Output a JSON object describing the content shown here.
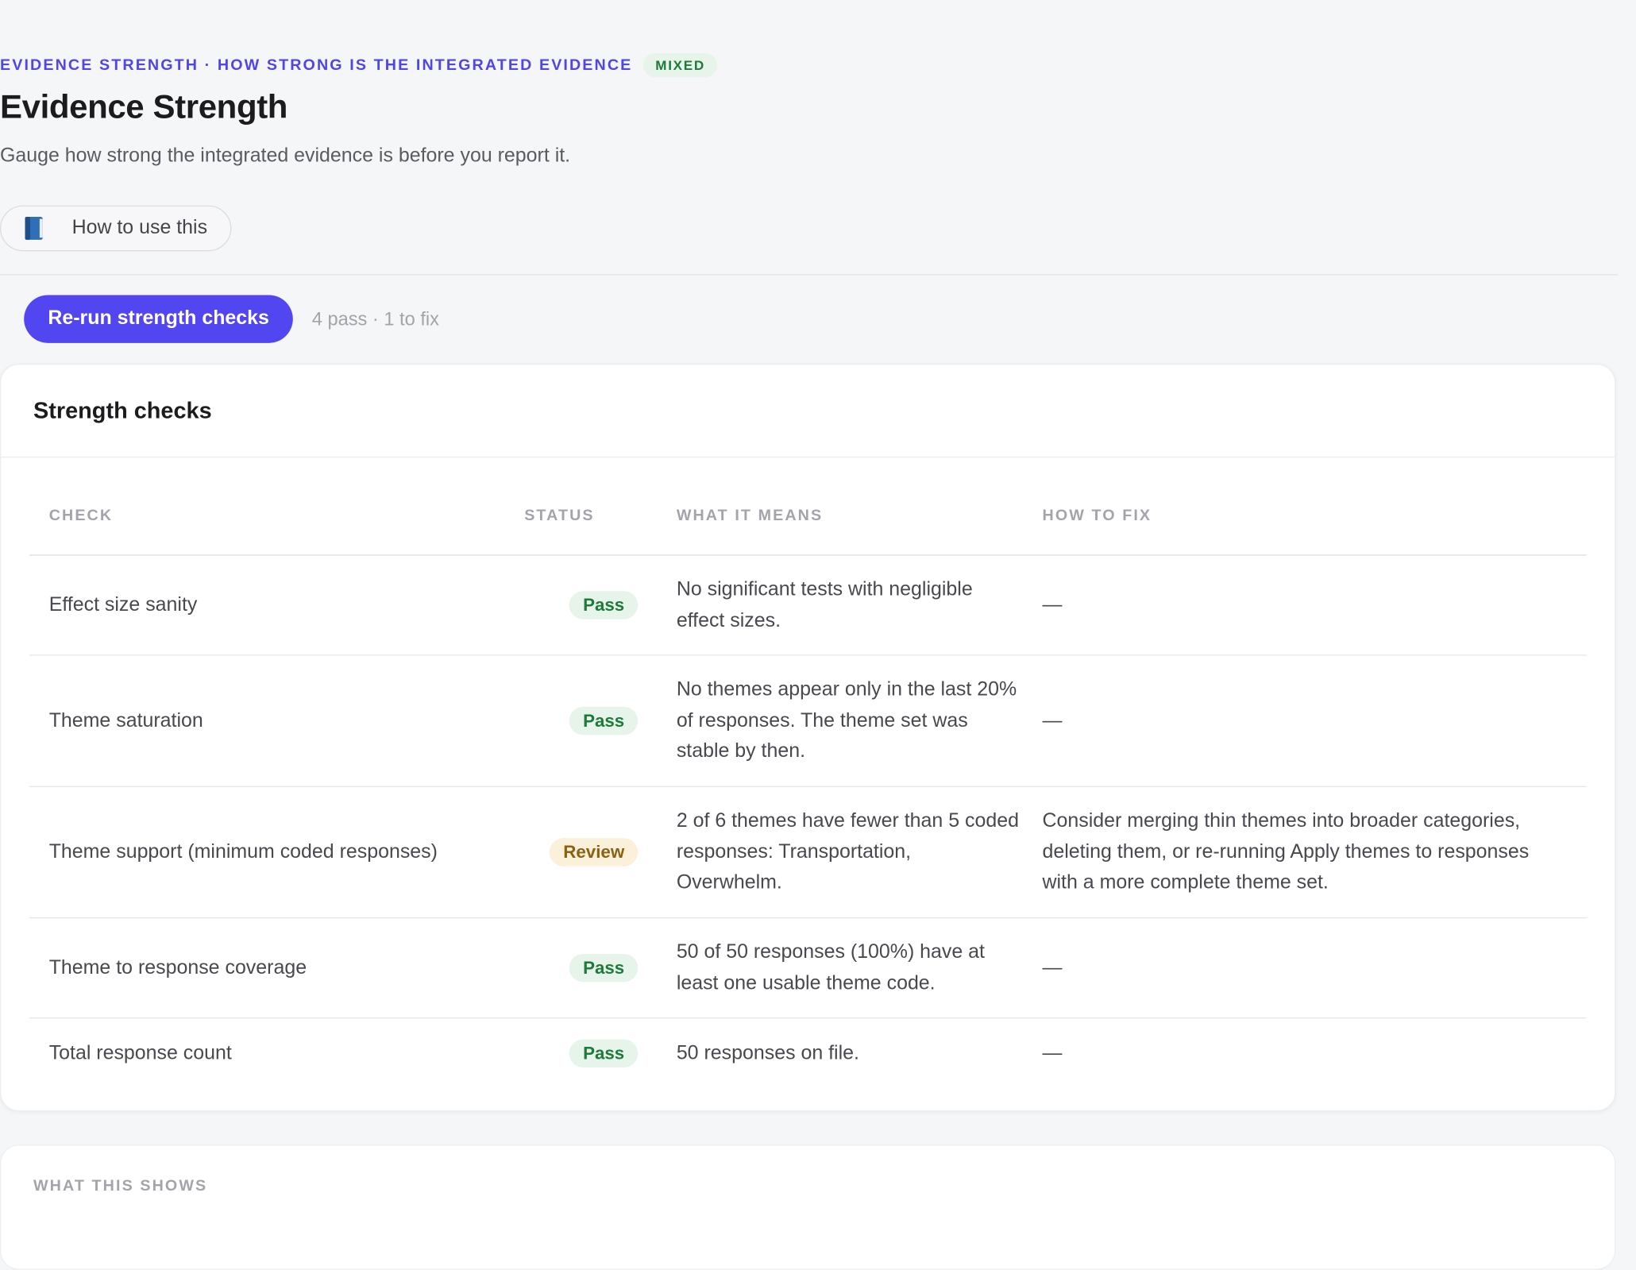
{
  "header": {
    "eyebrow": "EVIDENCE STRENGTH · HOW STRONG IS THE INTEGRATED EVIDENCE",
    "eyebrow_badge": "MIXED",
    "title": "Evidence Strength",
    "subtitle": "Gauge how strong the integrated evidence is before you report it.",
    "howto_label": "How to use this",
    "howto_icon": "book-icon"
  },
  "actions": {
    "rerun_label": "Re-run strength checks",
    "summary": "4 pass · 1 to fix"
  },
  "checks_card": {
    "title": "Strength checks",
    "columns": [
      "CHECK",
      "STATUS",
      "WHAT IT MEANS",
      "HOW TO FIX"
    ],
    "rows": [
      {
        "check": "Effect size sanity",
        "status": "Pass",
        "means": "No significant tests with negligible effect sizes.",
        "fix": "—"
      },
      {
        "check": "Theme saturation",
        "status": "Pass",
        "means": "No themes appear only in the last 20% of responses. The theme set was stable by then.",
        "fix": "—"
      },
      {
        "check": "Theme support (minimum coded responses)",
        "status": "Review",
        "means": "2 of 6 themes have fewer than 5 coded responses: Transportation, Overwhelm.",
        "fix": "Consider merging thin themes into broader categories, deleting them, or re-running Apply themes to responses with a more complete theme set."
      },
      {
        "check": "Theme to response coverage",
        "status": "Pass",
        "means": "50 of 50 responses (100%) have at least one usable theme code.",
        "fix": "—"
      },
      {
        "check": "Total response count",
        "status": "Pass",
        "means": "50 responses on file.",
        "fix": "—"
      }
    ]
  },
  "next_card": {
    "label": "WHAT THIS SHOWS"
  },
  "colors": {
    "accent": "#5146f0",
    "pass_bg": "#e6f4ea",
    "pass_text": "#1e7a3b",
    "review_bg": "#fbf0d9",
    "review_text": "#8a6212"
  }
}
